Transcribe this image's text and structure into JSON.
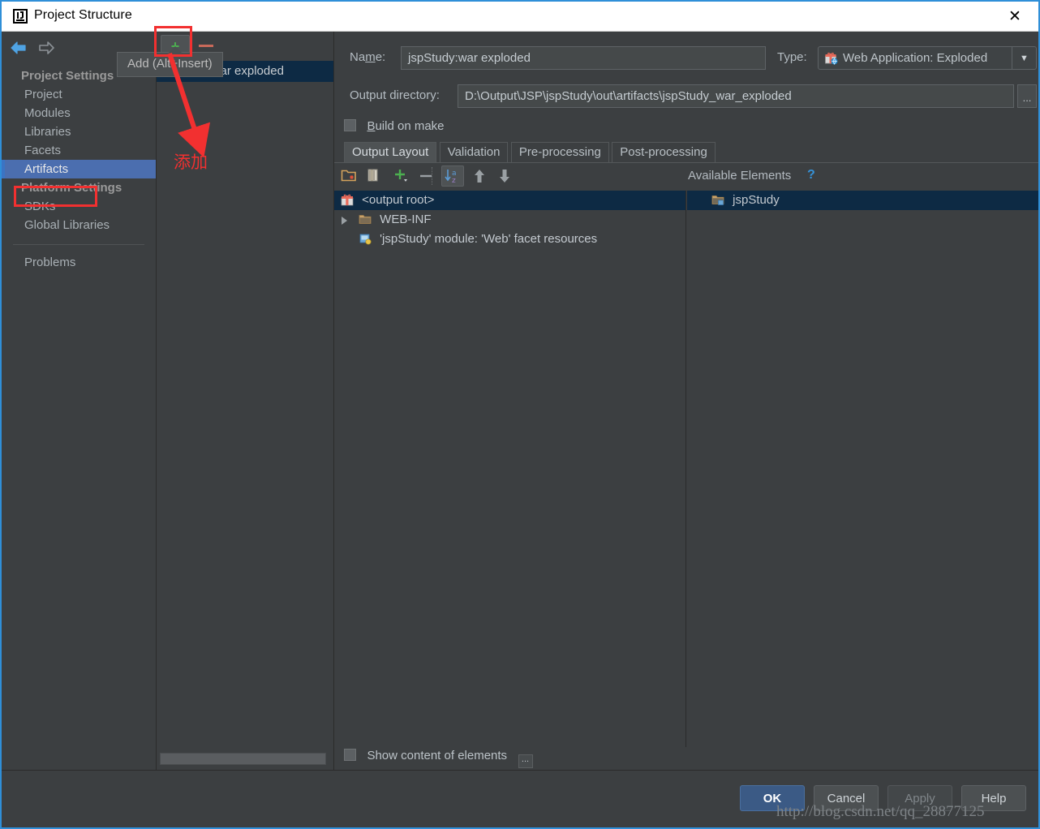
{
  "window": {
    "title": "Project Structure",
    "app_icon": "intellij-idea-icon",
    "close_icon": "close-icon",
    "border_color": "#2f8fd8"
  },
  "sidebar": {
    "back_icon": "back-arrow-icon",
    "forward_icon": "forward-arrow-icon",
    "groups": [
      {
        "label": "Project Settings",
        "items": [
          {
            "label": "Project",
            "selected": false
          },
          {
            "label": "Modules",
            "selected": false
          },
          {
            "label": "Libraries",
            "selected": false
          },
          {
            "label": "Facets",
            "selected": false
          },
          {
            "label": "Artifacts",
            "selected": true
          }
        ]
      },
      {
        "label": "Platform Settings",
        "items": [
          {
            "label": "SDKs",
            "selected": false
          },
          {
            "label": "Global Libraries",
            "selected": false
          }
        ]
      }
    ],
    "problems": {
      "label": "Problems"
    },
    "selected_color": "#4b6eaf"
  },
  "artifact_list": {
    "toolbar": {
      "add_icon": "plus-icon",
      "remove_icon": "minus-icon"
    },
    "items": [
      {
        "label": "jspStudy:war exploded",
        "selected": true
      }
    ],
    "scrollbar": "horizontal-scrollbar"
  },
  "tooltip": {
    "text": "Add (Alt+Insert)"
  },
  "annotations": {
    "add_box": "red-highlight-box",
    "artifacts_box": "red-highlight-box",
    "arrow": "red-arrow-icon",
    "arrow_label": "添加",
    "color": "#f23030"
  },
  "detail": {
    "name": {
      "label": "Name:",
      "label_underline_char": "m",
      "value": "jspStudy:war exploded"
    },
    "type": {
      "label": "Type:",
      "icon": "web-application-exploded-icon",
      "value": "Web Application: Exploded",
      "dropdown_icon": "chevron-down-icon"
    },
    "output_directory": {
      "label": "Output directory:",
      "value": "D:\\Output\\JSP\\jspStudy\\out\\artifacts\\jspStudy_war_exploded",
      "browse_label": "..."
    },
    "build_on_make": {
      "label": "Build on make",
      "underline_char": "B",
      "checked": false
    },
    "tabs": [
      {
        "label": "Output Layout",
        "active": true
      },
      {
        "label": "Validation",
        "active": false
      },
      {
        "label": "Pre-processing",
        "active": false
      },
      {
        "label": "Post-processing",
        "active": false
      }
    ],
    "output_layout_toolbar": {
      "icons": [
        "add-directory-icon",
        "add-archive-icon",
        "add-copy-icon",
        "remove-icon",
        "sort-az-icon",
        "move-up-icon",
        "move-down-icon"
      ]
    },
    "available_elements": {
      "label": "Available Elements",
      "help_icon": "help-question-icon"
    },
    "output_tree": [
      {
        "label": "<output root>",
        "icon": "artifact-root-icon",
        "indent": 1,
        "selected": true,
        "expandable": false
      },
      {
        "label": "WEB-INF",
        "icon": "folder-icon",
        "indent": 2,
        "selected": false,
        "expandable": true
      },
      {
        "label": "'jspStudy' module: 'Web' facet resources",
        "icon": "facet-resources-icon",
        "indent": 2,
        "selected": false,
        "expandable": false
      }
    ],
    "available_tree": [
      {
        "label": "jspStudy",
        "icon": "module-folder-icon",
        "indent": 2,
        "selected": false
      }
    ],
    "show_content": {
      "label": "Show content of elements",
      "checked": false,
      "more_label": "..."
    }
  },
  "footer": {
    "buttons": [
      {
        "label": "OK",
        "style": "primary"
      },
      {
        "label": "Cancel",
        "style": "normal"
      },
      {
        "label": "Apply",
        "style": "disabled"
      },
      {
        "label": "Help",
        "style": "normal"
      }
    ]
  },
  "watermark": {
    "text": "http://blog.csdn.net/qq_28877125"
  }
}
